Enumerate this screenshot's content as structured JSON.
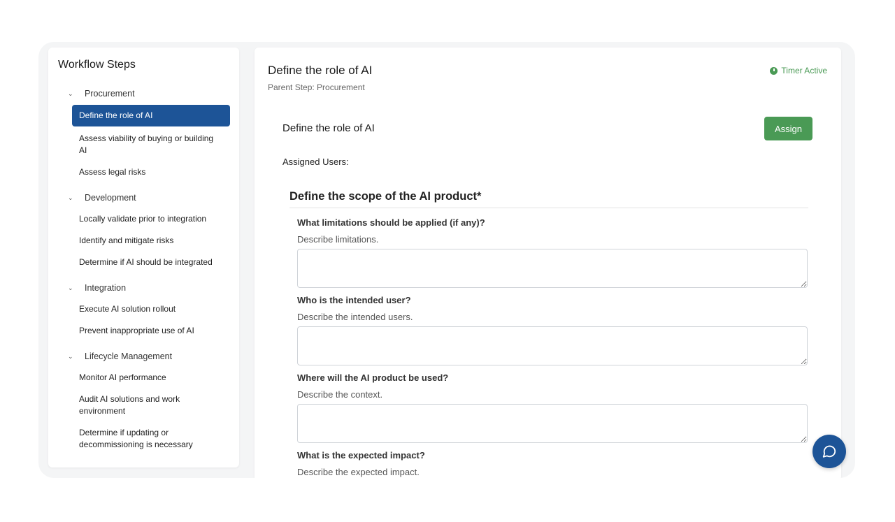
{
  "sidebar": {
    "title": "Workflow Steps",
    "groups": [
      {
        "label": "Procurement",
        "items": [
          {
            "label": "Define the role of AI",
            "active": true
          },
          {
            "label": "Assess viability of buying or building AI"
          },
          {
            "label": "Assess legal risks"
          }
        ]
      },
      {
        "label": "Development",
        "items": [
          {
            "label": "Locally validate prior to integration"
          },
          {
            "label": "Identify and mitigate risks"
          },
          {
            "label": "Determine if AI should be integrated"
          }
        ]
      },
      {
        "label": "Integration",
        "items": [
          {
            "label": "Execute AI solution rollout"
          },
          {
            "label": "Prevent inappropriate use of AI"
          }
        ]
      },
      {
        "label": "Lifecycle Management",
        "items": [
          {
            "label": "Monitor AI performance"
          },
          {
            "label": "Audit AI solutions and work environment"
          },
          {
            "label": "Determine if updating or decommissioning is necessary"
          }
        ]
      }
    ]
  },
  "main": {
    "title": "Define the role of AI",
    "parent_step": "Parent Step: Procurement",
    "timer": "Timer Active",
    "card_title": "Define the role of AI",
    "assign_label": "Assign",
    "assigned_users_label": "Assigned Users:",
    "section_title": "Define the scope of the AI product*",
    "questions": [
      {
        "label": "What limitations should be applied (if any)?",
        "description": "Describe limitations.",
        "value": ""
      },
      {
        "label": "Who is the intended user?",
        "description": "Describe the intended users.",
        "value": ""
      },
      {
        "label": "Where will the AI product be used?",
        "description": "Describe the context.",
        "value": ""
      },
      {
        "label": "What is the expected impact?",
        "description": "Describe the expected impact."
      }
    ]
  },
  "colors": {
    "accent_blue": "#1d5497",
    "success_green": "#4a9a55"
  },
  "icons": {
    "group_toggle": "chevron-down-icon",
    "timer": "clock-icon",
    "chat": "chat-bubble-icon"
  }
}
